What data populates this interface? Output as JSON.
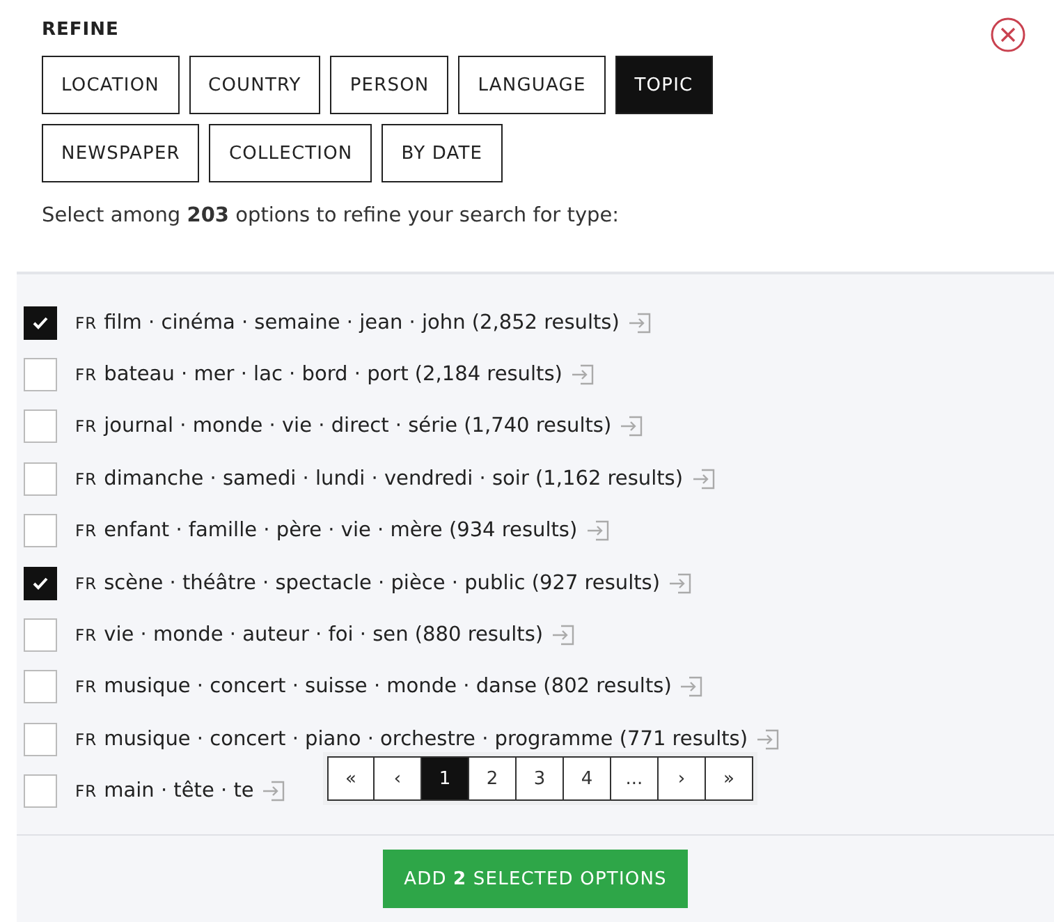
{
  "title": "REFINE",
  "tabs": [
    {
      "label": "LOCATION",
      "selected": false
    },
    {
      "label": "COUNTRY",
      "selected": false
    },
    {
      "label": "PERSON",
      "selected": false
    },
    {
      "label": "LANGUAGE",
      "selected": false
    },
    {
      "label": "TOPIC",
      "selected": true
    },
    {
      "label": "NEWSPAPER",
      "selected": false
    },
    {
      "label": "COLLECTION",
      "selected": false
    },
    {
      "label": "BY DATE",
      "selected": false
    }
  ],
  "intro": "Select among **203** options to refine your search for type:",
  "options": [
    {
      "lang": "FR",
      "label": "film · cinéma · semaine · jean · john (2,852 results)",
      "checked": true
    },
    {
      "lang": "FR",
      "label": "bateau · mer · lac · bord · port (2,184 results)",
      "checked": false
    },
    {
      "lang": "FR",
      "label": "journal · monde · vie · direct · série (1,740 results)",
      "checked": false
    },
    {
      "lang": "FR",
      "label": "dimanche · samedi · lundi · vendredi · soir (1,162 results)",
      "checked": false
    },
    {
      "lang": "FR",
      "label": "enfant · famille · père · vie · mère (934 results)",
      "checked": false
    },
    {
      "lang": "FR",
      "label": "scène · théâtre · spectacle · pièce · public (927 results)",
      "checked": true
    },
    {
      "lang": "FR",
      "label": "vie · monde · auteur · foi · sen (880 results)",
      "checked": false
    },
    {
      "lang": "FR",
      "label": "musique · concert · suisse · monde · danse (802 results)",
      "checked": false
    },
    {
      "lang": "FR",
      "label": "musique · concert · piano · orchestre · programme (771 results)",
      "checked": false
    },
    {
      "lang": "FR",
      "label": "main · tête · te",
      "checked": false
    }
  ],
  "pagination": [
    {
      "label": "«",
      "selected": false
    },
    {
      "label": "‹",
      "selected": false
    },
    {
      "label": "1",
      "selected": true
    },
    {
      "label": "2",
      "selected": false
    },
    {
      "label": "3",
      "selected": false
    },
    {
      "label": "4",
      "selected": false
    },
    {
      "label": "...",
      "selected": false
    },
    {
      "label": "›",
      "selected": false
    },
    {
      "label": "»",
      "selected": false
    }
  ],
  "apply_button": "ADD **2** SELECTED OPTIONS"
}
